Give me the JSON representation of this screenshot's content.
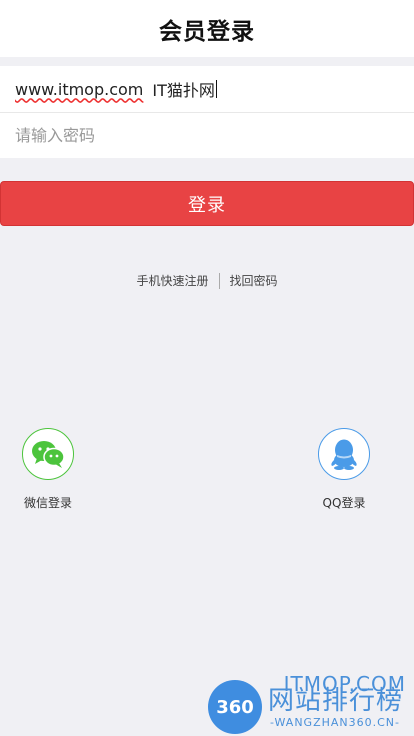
{
  "header": {
    "title": "会员登录"
  },
  "form": {
    "username_url": "www.itmop.com",
    "username_suffix": "IT猫扑网",
    "password_placeholder": "请输入密码"
  },
  "login_button": {
    "label": "登录"
  },
  "links": {
    "register": "手机快速注册",
    "recover": "找回密码"
  },
  "social": {
    "wechat_label": "微信登录",
    "qq_label": "QQ登录"
  },
  "colors": {
    "accent": "#e84344",
    "wechat": "#4cc43c",
    "qq": "#4a9be8"
  },
  "watermark": {
    "top": "ITMOP.COM",
    "logo": "360",
    "cn": "网站排行榜",
    "sub": "-WANGZHAN360.CN-"
  }
}
